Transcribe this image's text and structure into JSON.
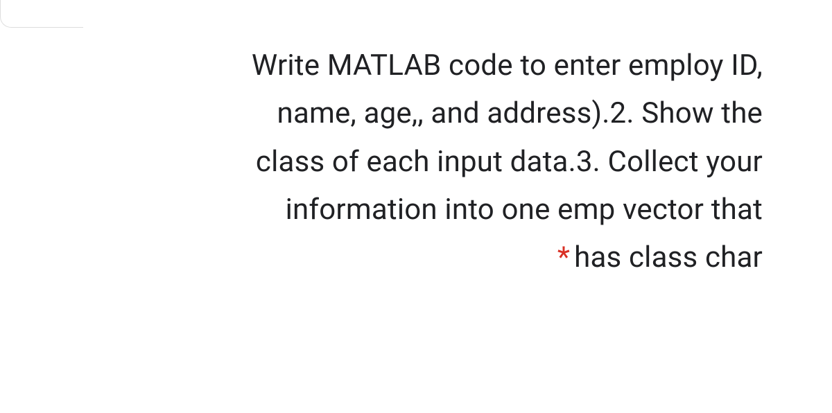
{
  "question": {
    "line1": "Write MATLAB code to enter employ ID,",
    "line2": "name, age,, and address).2. Show the",
    "line3": "class of each input data.3. Collect your",
    "line4": "information into one emp vector that",
    "line5_suffix": "has class char",
    "required_marker": "*"
  }
}
